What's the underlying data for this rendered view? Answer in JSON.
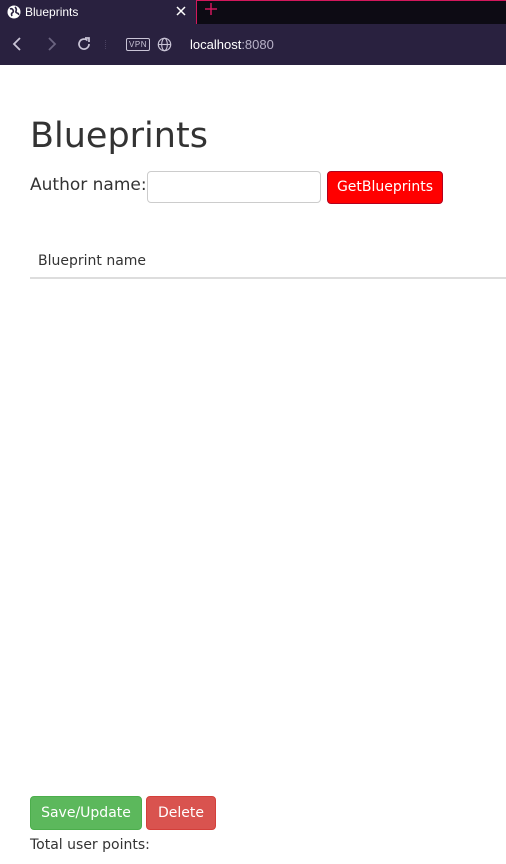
{
  "browser": {
    "tab_title": "Blueprints",
    "new_tab_symbol": "+",
    "vpn_badge": "VPN",
    "url_host": "localhost",
    "url_port": ":8080",
    "icons": [
      "globe-icon",
      "close-icon",
      "new-tab-icon",
      "back-icon",
      "forward-icon",
      "reload-icon",
      "site-info-icon"
    ],
    "accent_color": "#d2185c"
  },
  "page": {
    "heading": "Blueprints",
    "author_label": "Author name:",
    "author_input_value": "",
    "get_button_label": "GetBlueprints",
    "table": {
      "headers": [
        "Blueprint name"
      ],
      "rows": []
    },
    "save_button_label": "Save/Update",
    "delete_button_label": "Delete",
    "total_points_label": "Total user points:"
  },
  "colors": {
    "get_button": "#ff0000",
    "save_button": "#5cb85c",
    "delete_button": "#d9534f",
    "text": "#333333"
  }
}
